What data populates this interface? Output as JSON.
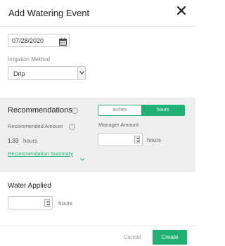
{
  "dialog": {
    "title": "Add Watering Event"
  },
  "date": {
    "value": "07/28/2020"
  },
  "irrigation": {
    "label": "Irrigation Method",
    "selected": "Drip"
  },
  "recommendations": {
    "title": "Recommendations",
    "toggle": {
      "inches": "inches",
      "hours": "hours",
      "active": "hours"
    },
    "recommended_label": "Recommended Amount",
    "recommended_value": "1.33",
    "recommended_unit": "hours",
    "manager_label": "Manager Amount",
    "manager_value": "",
    "manager_unit": "hours",
    "summary_link": "Recommendation Summary"
  },
  "water_applied": {
    "title": "Water Applied",
    "value": "",
    "unit": "hours"
  },
  "footer": {
    "cancel": "Cancel",
    "create": "Create"
  },
  "colors": {
    "accent": "#20b073",
    "panel_bg": "#efefef"
  },
  "icons": {
    "close": "close-icon",
    "calendar": "calendar-icon",
    "info": "info-icon",
    "dropdown": "chevron-down-icon",
    "spinner": "spinner-icon"
  }
}
